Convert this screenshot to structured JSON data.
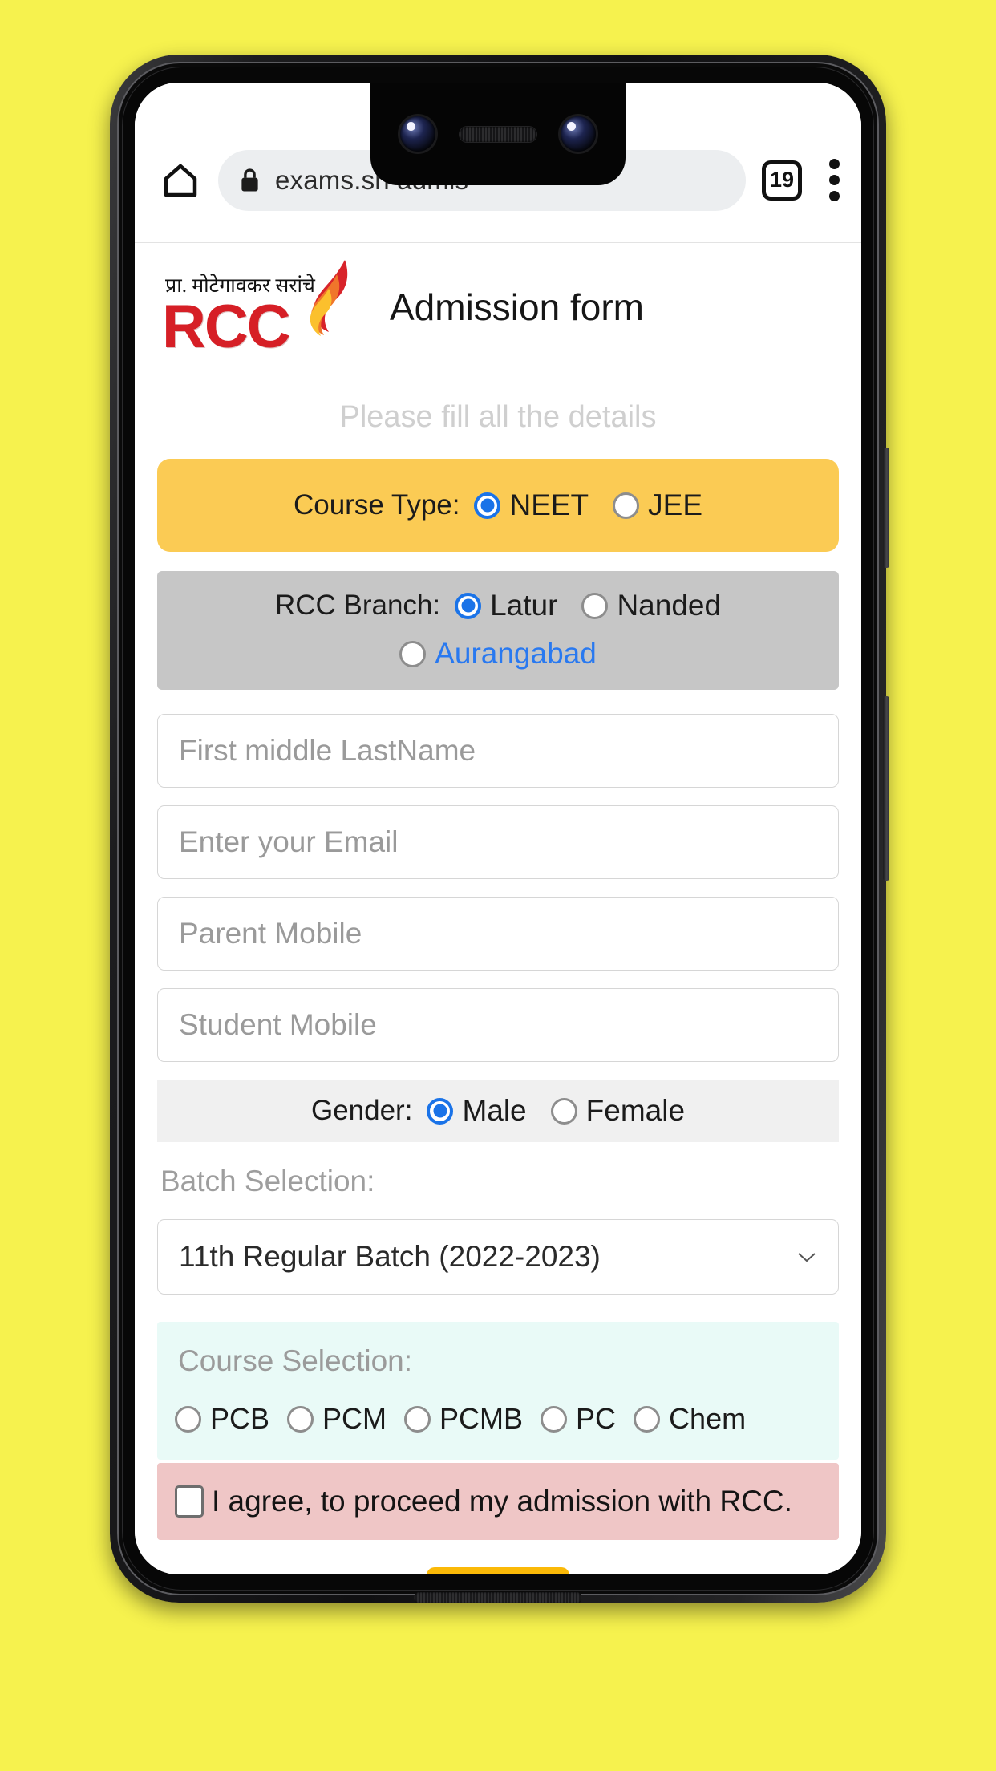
{
  "browser": {
    "home_icon": "home-icon",
    "lock_icon": "lock-icon",
    "url": "exams.sh                       admis",
    "tab_count": "19",
    "menu_icon": "three-dot-menu-icon"
  },
  "header": {
    "logo_marathi": "प्रा. मोटेगावकर सरांचे",
    "logo_text": "RCC",
    "logo_flame_icon": "flame-icon",
    "title": "Admission form"
  },
  "form": {
    "subtitle": "Please fill all the details",
    "course_type": {
      "label": "Course Type:",
      "options": [
        {
          "label": "NEET",
          "selected": true
        },
        {
          "label": "JEE",
          "selected": false
        }
      ]
    },
    "branch": {
      "label": "RCC Branch:",
      "options": [
        {
          "label": "Latur",
          "selected": true
        },
        {
          "label": "Nanded",
          "selected": false
        },
        {
          "label": "Aurangabad",
          "selected": false
        }
      ]
    },
    "fields": [
      {
        "name": "full-name",
        "placeholder": "First middle LastName",
        "value": ""
      },
      {
        "name": "email",
        "placeholder": "Enter your Email",
        "value": ""
      },
      {
        "name": "parent-mobile",
        "placeholder": "Parent Mobile",
        "value": ""
      },
      {
        "name": "student-mobile",
        "placeholder": "Student Mobile",
        "value": ""
      }
    ],
    "gender": {
      "label": "Gender:",
      "options": [
        {
          "label": "Male",
          "selected": true
        },
        {
          "label": "Female",
          "selected": false
        }
      ]
    },
    "batch": {
      "label": "Batch Selection:",
      "selected": "11th Regular Batch (2022-2023)",
      "chevron_icon": "chevron-down-icon"
    },
    "course_selection": {
      "label": "Course Selection:",
      "options": [
        {
          "label": "PCB",
          "selected": false
        },
        {
          "label": "PCM",
          "selected": false
        },
        {
          "label": "PCMB",
          "selected": false
        },
        {
          "label": "PC",
          "selected": false
        },
        {
          "label": "Chem",
          "selected": false
        }
      ]
    },
    "agreement": {
      "label": "I agree, to proceed my admission with RCC.",
      "checked": false
    },
    "submit_label": ""
  },
  "colors": {
    "page_background": "#F6F24E",
    "course_type_band": "#FBCB54",
    "branch_band": "#C6C6C6",
    "gender_band": "#F0F0F0",
    "course_selection_band": "#E9FAF7",
    "agree_band": "#EFC6C6",
    "submit_button": "#FBB907",
    "radio_accent": "#1A73E8",
    "link_blue": "#2979F0",
    "logo_red": "#D61F26"
  }
}
